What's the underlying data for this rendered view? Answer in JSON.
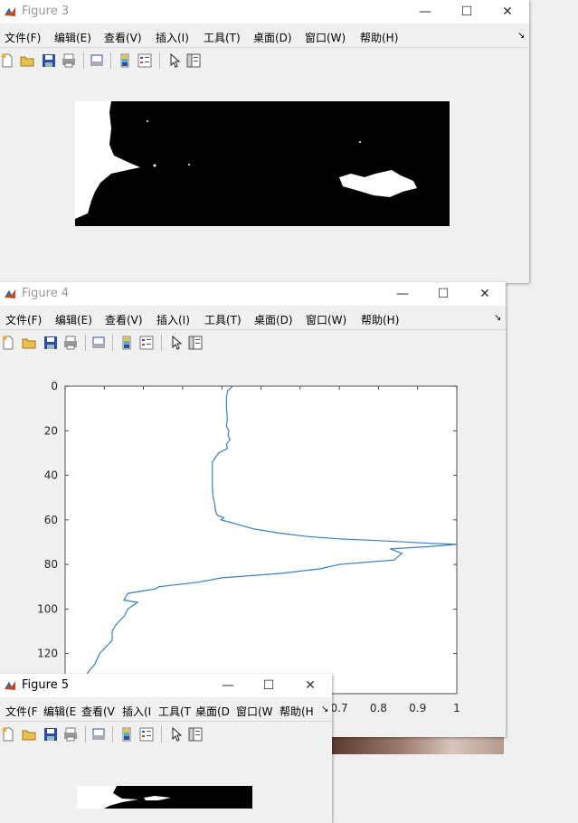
{
  "windows": {
    "fig3": {
      "title": "Figure 3"
    },
    "fig4": {
      "title": "Figure 4"
    },
    "fig5": {
      "title": "Figure 5"
    }
  },
  "menu_full": [
    "文件(F)",
    "编辑(E)",
    "查看(V)",
    "插入(I)",
    "工具(T)",
    "桌面(D)",
    "窗口(W)",
    "帮助(H)"
  ],
  "menu_truncated": [
    "文件(F",
    "编辑(E",
    "查看(V",
    "插入(I",
    "工具(T",
    "桌面(D",
    "窗口(W",
    "帮助(H"
  ],
  "menu_more": "↘",
  "window_buttons": {
    "minimize": "—",
    "maximize": "☐",
    "close": "✕"
  },
  "icons": [
    "new-figure-icon",
    "open-file-icon",
    "save-icon",
    "print-icon",
    "print-preview-icon",
    "colorbar-icon",
    "legend-icon",
    "pointer-icon",
    "property-editor-icon"
  ],
  "chart_data": {
    "type": "line",
    "title": "",
    "xlabel": "",
    "ylabel": "",
    "y_reversed": true,
    "ylim": [
      0,
      138
    ],
    "xlim": [
      0,
      1
    ],
    "yticks": [
      0,
      20,
      40,
      60,
      80,
      100,
      120
    ],
    "xticks_visible": [
      "0.7",
      "0.8",
      "0.9",
      "1"
    ],
    "series": [
      {
        "color": "#3a7fc1",
        "points": [
          [
            0.428,
            0
          ],
          [
            0.415,
            2
          ],
          [
            0.412,
            5
          ],
          [
            0.412,
            10
          ],
          [
            0.414,
            14
          ],
          [
            0.412,
            18
          ],
          [
            0.418,
            20
          ],
          [
            0.416,
            22
          ],
          [
            0.421,
            24
          ],
          [
            0.412,
            26
          ],
          [
            0.414,
            28
          ],
          [
            0.392,
            30
          ],
          [
            0.376,
            34
          ],
          [
            0.376,
            38
          ],
          [
            0.376,
            42
          ],
          [
            0.376,
            46
          ],
          [
            0.378,
            50
          ],
          [
            0.382,
            53
          ],
          [
            0.384,
            56
          ],
          [
            0.389,
            58
          ],
          [
            0.405,
            59
          ],
          [
            0.398,
            60
          ],
          [
            0.441,
            62
          ],
          [
            0.48,
            64
          ],
          [
            0.55,
            66
          ],
          [
            0.62,
            67.5
          ],
          [
            0.7,
            68.5
          ],
          [
            0.82,
            69.5
          ],
          [
            0.93,
            70.5
          ],
          [
            1.0,
            71
          ],
          [
            0.93,
            72
          ],
          [
            0.83,
            73
          ],
          [
            0.86,
            75
          ],
          [
            0.84,
            78
          ],
          [
            0.7,
            80
          ],
          [
            0.65,
            82
          ],
          [
            0.55,
            84
          ],
          [
            0.4,
            86
          ],
          [
            0.34,
            88
          ],
          [
            0.24,
            90
          ],
          [
            0.23,
            91
          ],
          [
            0.16,
            93
          ],
          [
            0.15,
            96
          ],
          [
            0.185,
            97
          ],
          [
            0.16,
            100
          ],
          [
            0.152,
            103
          ],
          [
            0.13,
            107
          ],
          [
            0.12,
            110
          ],
          [
            0.12,
            114
          ],
          [
            0.088,
            120
          ],
          [
            0.075,
            125
          ],
          [
            0.06,
            128
          ],
          [
            0.045,
            132
          ],
          [
            0.03,
            136
          ]
        ]
      }
    ]
  }
}
